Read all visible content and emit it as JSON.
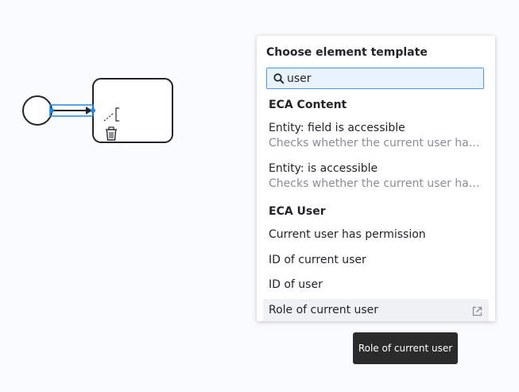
{
  "popup": {
    "title": "Choose element template",
    "search": {
      "value": "user",
      "placeholder": ""
    },
    "groups": [
      {
        "title": "ECA Content",
        "entries": [
          {
            "label": "Entity: field is accessible",
            "description": "Checks whether the current user has o..."
          },
          {
            "label": "Entity: is accessible",
            "description": "Checks whether the current user has o..."
          }
        ]
      },
      {
        "title": "ECA User",
        "entries": [
          {
            "label": "Current user has permission"
          },
          {
            "label": "ID of current user"
          },
          {
            "label": "ID of user"
          },
          {
            "label": "Role of current user",
            "selected": true,
            "icon": "external-link-icon"
          }
        ]
      }
    ]
  },
  "tooltip": {
    "text": "Role of current user"
  },
  "colors": {
    "selection": "#1e88e5",
    "stroke": "#22242a",
    "search_border": "#4d90ff",
    "search_bg": "#e9f3fd",
    "selected_row": "#f0f1f4"
  },
  "icons": [
    "search-icon",
    "connect-icon",
    "trash-icon",
    "external-link-icon"
  ]
}
